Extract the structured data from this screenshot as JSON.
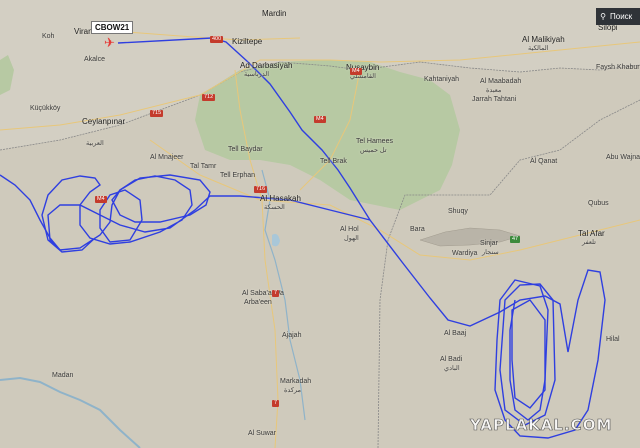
{
  "search": {
    "label": "Поиск",
    "icon": "search-icon"
  },
  "aircraft": {
    "callsign": "CBOW21",
    "icon": "airplane-icon",
    "color": "#e53935"
  },
  "track_color": "#2f3fe0",
  "watermark": "YAPLAKAL.COM",
  "places": {
    "mardin": "Mardin",
    "viransehir": "Viran",
    "koh": "Koh",
    "kiziltepe": "Kiziltepe",
    "akalce": "Akalce",
    "ceylanpinar": "Ceylanpınar",
    "ceylanpinar_ar": "العربية",
    "ad_darbasiyah": "Ad Darbasiyah",
    "ad_darbasiyah_ar": "الدرباسية",
    "nusaybin": "Nusaybin",
    "qamishli_ar": "القامشلي",
    "kahtaniyah": "Kahtaniyah",
    "al_malikiyah": "Al Malikiyah",
    "al_malikiyah_ar": "المالكية",
    "silopi": "Silopi",
    "fishkhabur": "Faysh Khabur",
    "al_mabada": "Al Maabadah",
    "al_mabada_ar": "معبدة",
    "jarrah_tahtani": "Jarrah Tahtani",
    "tall_baydar": "Tell Baydar",
    "tell_hamees": "Tel Hamees",
    "tell_hamees_ar": "تل حميس",
    "tell_brak": "Tell Brak",
    "al_qahtaniyah2": "Al Qanat",
    "abu_wajnam": "Abu Wajnam",
    "al_hasakah": "Al Hasakah",
    "al_hasakah_ar": "الحسكة",
    "tal_tamr": "Tal Tamr",
    "tell_erphan": "Tell Erphan",
    "al_mnajeer": "Al Mnajeer",
    "tal_afar": "Tal Afar",
    "tal_afar_ar": "تلعفر",
    "sinjar": "Sinjar",
    "sinjar_ar": "سنجار",
    "wardiya": "Wardiya",
    "bara": "Bara",
    "shuqy": "Shuqy",
    "al_sabaa": "Al Saba'a Wa",
    "arbaeen": "Arba'een",
    "al_hol": "Al Hol",
    "al_hol_ar": "الهول",
    "al_baaj": "Al Baaj",
    "al_badi": "Al Badi",
    "al_badi_ar": "البادي",
    "ajaja": "Ajajah",
    "markadah": "Markadah",
    "markadah_ar": "مركدة",
    "al_suwar": "Al Suwar",
    "madan": "Madan",
    "qubus": "Qubus",
    "kucukkoy": "Küçükköy",
    "hilal": "Hilal"
  },
  "roads": [
    "712",
    "715",
    "M4",
    "M4",
    "716",
    "7",
    "400",
    "47",
    "M4",
    "7"
  ]
}
